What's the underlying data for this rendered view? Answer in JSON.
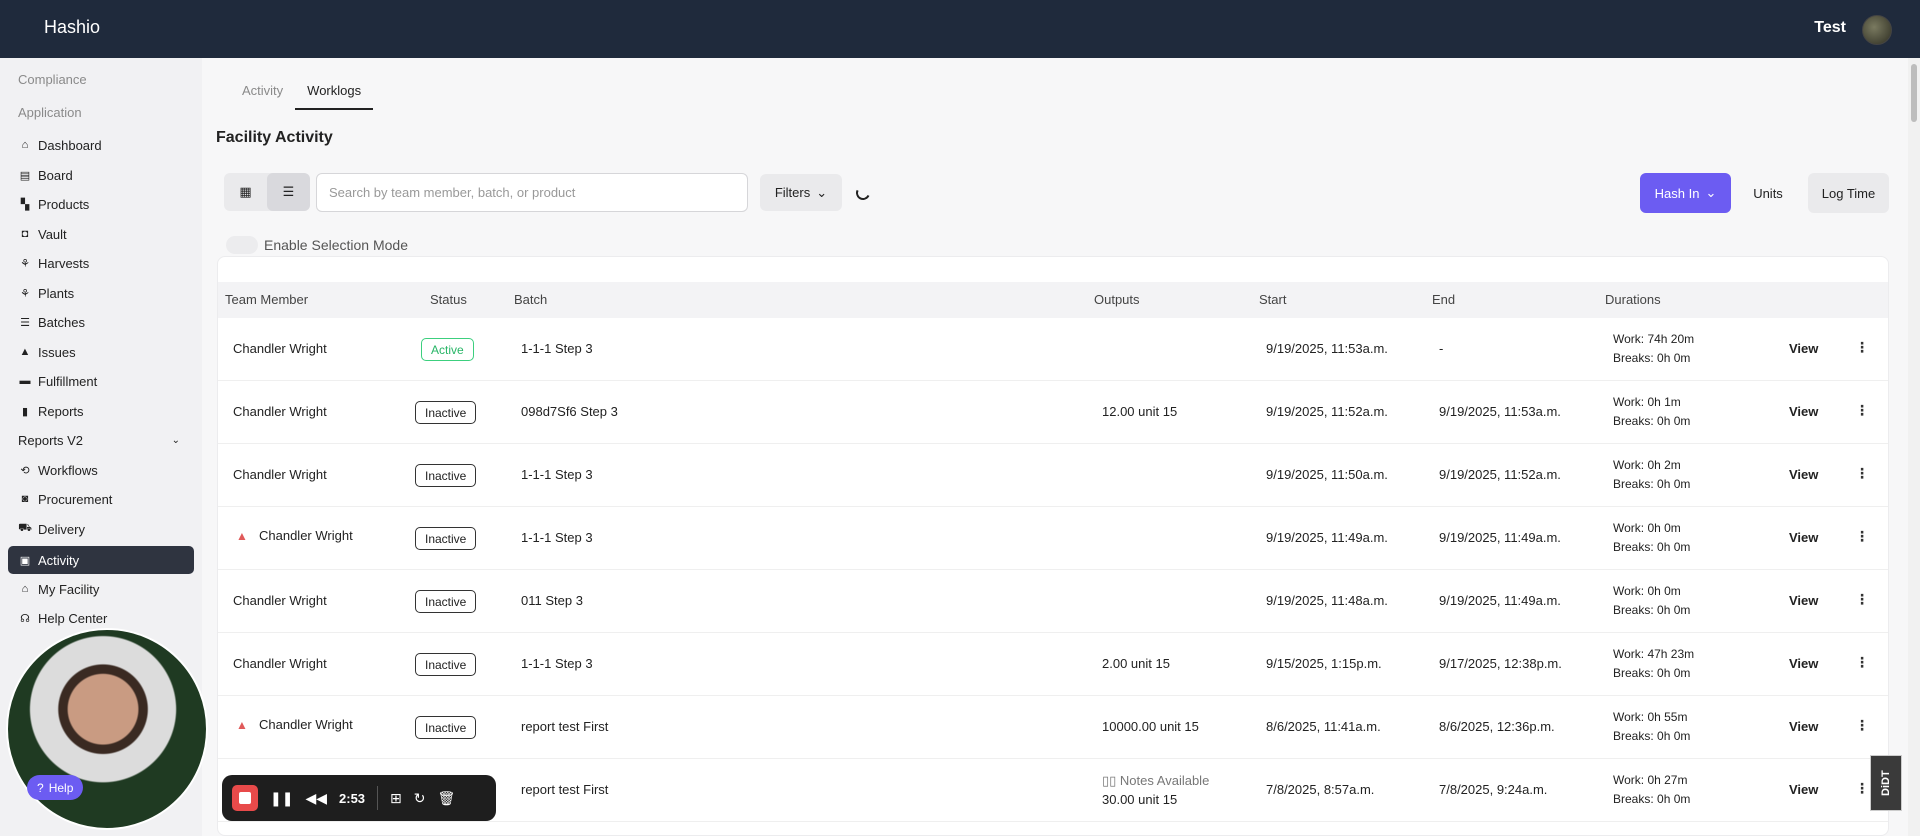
{
  "app": {
    "brand": "Hashio",
    "user": "Test"
  },
  "sidebar": {
    "sections": [
      "Compliance",
      "Application"
    ],
    "items": [
      {
        "label": "Dashboard",
        "icon": "home-icon",
        "glyph": "⌂"
      },
      {
        "label": "Board",
        "icon": "board-icon",
        "glyph": "▤"
      },
      {
        "label": "Products",
        "icon": "products-icon",
        "glyph": "▚"
      },
      {
        "label": "Vault",
        "icon": "vault-icon",
        "glyph": "◘"
      },
      {
        "label": "Harvests",
        "icon": "harvest-icon",
        "glyph": "⚘"
      },
      {
        "label": "Plants",
        "icon": "plant-icon",
        "glyph": "⚘"
      },
      {
        "label": "Batches",
        "icon": "batches-icon",
        "glyph": "☰"
      },
      {
        "label": "Issues",
        "icon": "warning-icon",
        "glyph": "▲"
      },
      {
        "label": "Fulfillment",
        "icon": "fulfillment-icon",
        "glyph": "▬"
      },
      {
        "label": "Reports",
        "icon": "bar-chart-icon",
        "glyph": "▮"
      },
      {
        "label": "Reports V2",
        "icon": "",
        "glyph": ""
      },
      {
        "label": "Workflows",
        "icon": "workflow-icon",
        "glyph": "⟲"
      },
      {
        "label": "Procurement",
        "icon": "bag-icon",
        "glyph": "◙"
      },
      {
        "label": "Delivery",
        "icon": "truck-icon",
        "glyph": "⛟"
      },
      {
        "label": "Activity",
        "icon": "activity-icon",
        "glyph": "▣"
      },
      {
        "label": "My Facility",
        "icon": "facility-icon",
        "glyph": "⌂"
      },
      {
        "label": "Help Center",
        "icon": "headset-icon",
        "glyph": "☊"
      }
    ]
  },
  "tabs": [
    "Activity",
    "Worklogs"
  ],
  "page_title": "Facility Activity",
  "toolbar": {
    "search_placeholder": "Search by team member, batch, or product",
    "filters": "Filters",
    "hash_in": "Hash In",
    "units": "Units",
    "log_time": "Log Time",
    "selection_mode": "Enable Selection Mode"
  },
  "table": {
    "headers": [
      "Team Member",
      "Status",
      "Batch",
      "Outputs",
      "Start",
      "End",
      "Durations"
    ],
    "view_label": "View",
    "rows": [
      {
        "member": "Chandler Wright",
        "warn": false,
        "status": "Active",
        "batch": "1-1-1 Step 3",
        "outputs": "",
        "notes": "",
        "start": "9/19/2025, 11:53a.m.",
        "end": "-",
        "work": "Work: 74h 20m",
        "breaks": "Breaks: 0h 0m"
      },
      {
        "member": "Chandler Wright",
        "warn": false,
        "status": "Inactive",
        "batch": "098d7Sf6 Step 3",
        "outputs": "12.00 unit 15",
        "notes": "",
        "start": "9/19/2025, 11:52a.m.",
        "end": "9/19/2025, 11:53a.m.",
        "work": "Work: 0h 1m",
        "breaks": "Breaks: 0h 0m"
      },
      {
        "member": "Chandler Wright",
        "warn": false,
        "status": "Inactive",
        "batch": "1-1-1 Step 3",
        "outputs": "",
        "notes": "",
        "start": "9/19/2025, 11:50a.m.",
        "end": "9/19/2025, 11:52a.m.",
        "work": "Work: 0h 2m",
        "breaks": "Breaks: 0h 0m"
      },
      {
        "member": "Chandler Wright",
        "warn": true,
        "status": "Inactive",
        "batch": "1-1-1 Step 3",
        "outputs": "",
        "notes": "",
        "start": "9/19/2025, 11:49a.m.",
        "end": "9/19/2025, 11:49a.m.",
        "work": "Work: 0h 0m",
        "breaks": "Breaks: 0h 0m"
      },
      {
        "member": "Chandler Wright",
        "warn": false,
        "status": "Inactive",
        "batch": "011 Step 3",
        "outputs": "",
        "notes": "",
        "start": "9/19/2025, 11:48a.m.",
        "end": "9/19/2025, 11:49a.m.",
        "work": "Work: 0h 0m",
        "breaks": "Breaks: 0h 0m"
      },
      {
        "member": "Chandler Wright",
        "warn": false,
        "status": "Inactive",
        "batch": "1-1-1 Step 3",
        "outputs": "2.00 unit 15",
        "notes": "",
        "start": "9/15/2025, 1:15p.m.",
        "end": "9/17/2025, 12:38p.m.",
        "work": "Work: 47h 23m",
        "breaks": "Breaks: 0h 0m"
      },
      {
        "member": "Chandler Wright",
        "warn": true,
        "status": "Inactive",
        "batch": "report test First",
        "outputs": "10000.00 unit 15",
        "notes": "",
        "start": "8/6/2025, 11:41a.m.",
        "end": "8/6/2025, 12:36p.m.",
        "work": "Work: 0h 55m",
        "breaks": "Breaks: 0h 0m"
      },
      {
        "member": "",
        "warn": false,
        "status": "",
        "batch": "report test First",
        "outputs": "30.00 unit 15",
        "notes": "Notes Available",
        "start": "7/8/2025, 8:57a.m.",
        "end": "7/8/2025, 9:24a.m.",
        "work": "Work: 0h 27m",
        "breaks": "Breaks: 0h 0m"
      }
    ]
  },
  "overlay": {
    "help": "Help",
    "timer": "2:53",
    "watermark": "DiDT"
  },
  "colors": {
    "topbar": "#1f2a3c",
    "accent": "#6c5cf2",
    "active_badge": "#27b566",
    "warning": "#e05a5a"
  }
}
